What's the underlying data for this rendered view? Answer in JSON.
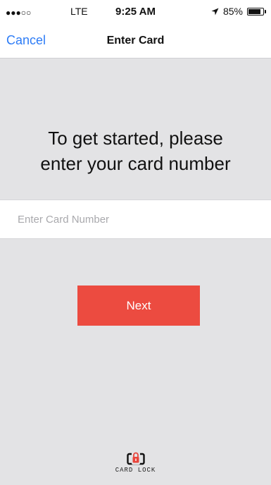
{
  "status_bar": {
    "signal": "●●●○○",
    "carrier": "LTE",
    "time": "9:25 AM",
    "battery": "85%",
    "battery_level": 0.85
  },
  "nav": {
    "cancel": "Cancel",
    "title": "Enter Card"
  },
  "main": {
    "headline_line1": "To get started, please",
    "headline_line2": "enter your card number",
    "card_input_value": "",
    "card_input_placeholder": "Enter Card Number",
    "next_label": "Next"
  },
  "logo": {
    "text": "CARD LOCK"
  },
  "colors": {
    "accent": "#2d7cf6",
    "button": "#ec4b40",
    "background": "#e3e3e5"
  }
}
